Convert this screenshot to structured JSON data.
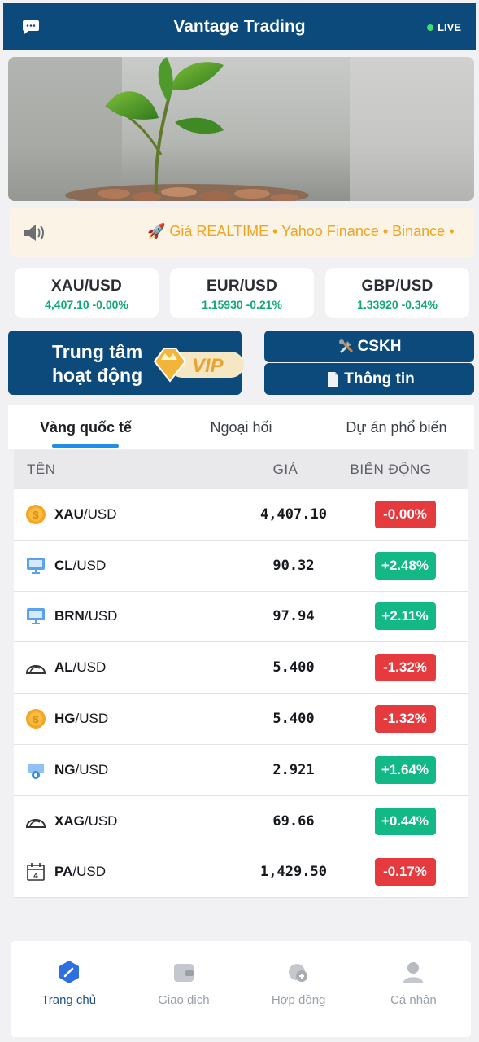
{
  "header": {
    "title": "Vantage Trading",
    "live_label": "LIVE"
  },
  "ticker": {
    "text": "🚀 Giá REALTIME • Yahoo Finance • Binance •"
  },
  "quotes": [
    {
      "symbol": "XAU/USD",
      "price": "4,407.10",
      "change": "-0.00%"
    },
    {
      "symbol": "EUR/USD",
      "price": "1.15930",
      "change": "-0.21%"
    },
    {
      "symbol": "GBP/USD",
      "price": "1.33920",
      "change": "-0.34%"
    }
  ],
  "vip_card": {
    "line1": "Trung tâm",
    "line2": "hoạt động",
    "badge": "VIP"
  },
  "buttons": {
    "support": "CSKH",
    "info": "Thông tin"
  },
  "tabs": [
    "Vàng quốc tế",
    "Ngoại hối",
    "Dự án phổ biến"
  ],
  "table": {
    "headers": {
      "name": "TÊN",
      "price": "GIÁ",
      "change": "BIẾN ĐỘNG"
    },
    "rows": [
      {
        "base": "XAU",
        "quote": "/USD",
        "price": "4,407.10",
        "change": "-0.00%",
        "icon": "coin-icon"
      },
      {
        "base": "CL",
        "quote": "/USD",
        "price": "90.32",
        "change": "+2.48%",
        "icon": "monitor-icon"
      },
      {
        "base": "BRN",
        "quote": "/USD",
        "price": "97.94",
        "change": "+2.11%",
        "icon": "monitor-icon"
      },
      {
        "base": "AL",
        "quote": "/USD",
        "price": "5.400",
        "change": "-1.32%",
        "icon": "taco-icon"
      },
      {
        "base": "HG",
        "quote": "/USD",
        "price": "5.400",
        "change": "-1.32%",
        "icon": "coin-icon"
      },
      {
        "base": "NG",
        "quote": "/USD",
        "price": "2.921",
        "change": "+1.64%",
        "icon": "gear-box-icon"
      },
      {
        "base": "XAG",
        "quote": "/USD",
        "price": "69.66",
        "change": "+0.44%",
        "icon": "taco-icon"
      },
      {
        "base": "PA",
        "quote": "/USD",
        "price": "1,429.50",
        "change": "-0.17%",
        "icon": "calendar-icon"
      }
    ]
  },
  "nav": [
    {
      "label": "Trang chủ",
      "icon": "home-icon"
    },
    {
      "label": "Giao dịch",
      "icon": "wallet-icon"
    },
    {
      "label": "Hợp đồng",
      "icon": "contract-icon"
    },
    {
      "label": "Cá nhân",
      "icon": "user-icon"
    }
  ],
  "colors": {
    "primary": "#0c4a7c",
    "up": "#12b886",
    "down": "#e53a3e",
    "ticker": "#f0a41f"
  }
}
